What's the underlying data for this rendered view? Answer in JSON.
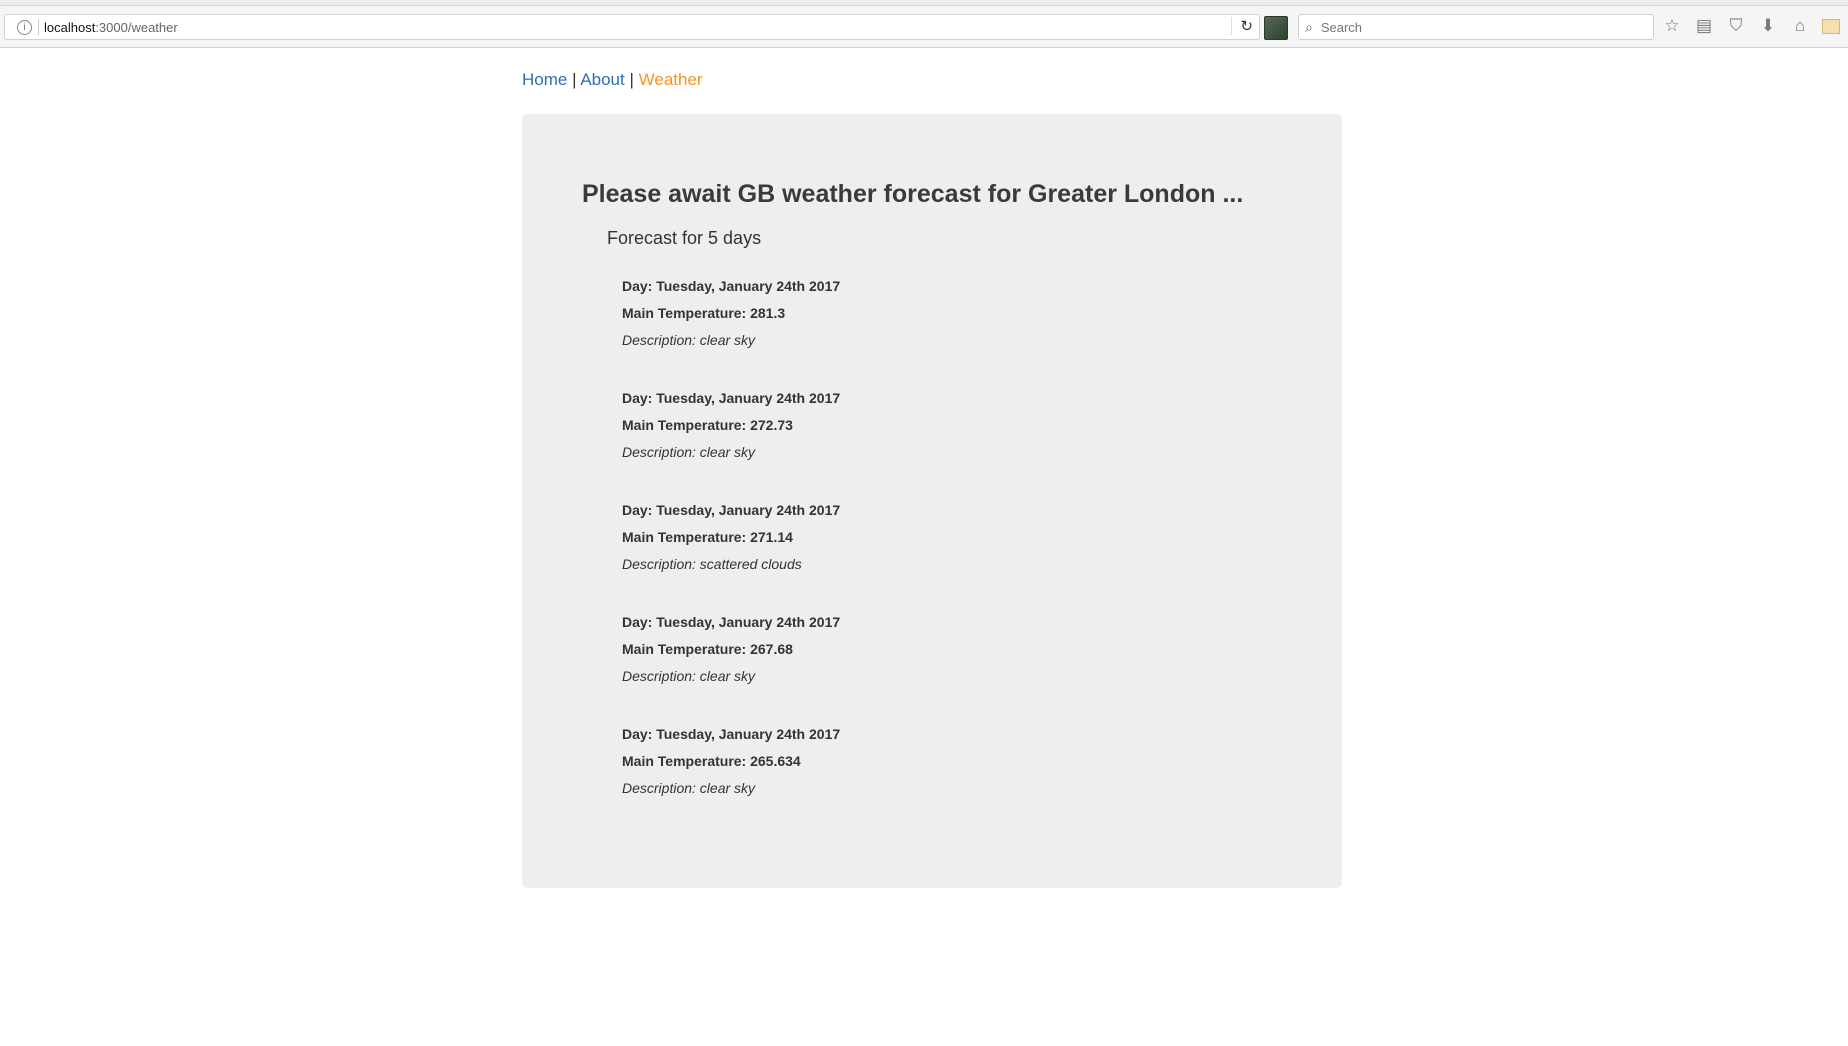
{
  "browser": {
    "url_host": "localhost",
    "url_rest": ":3000/weather",
    "search_placeholder": "Search"
  },
  "nav": {
    "home": "Home",
    "about": "About",
    "weather": "Weather",
    "separator": "|"
  },
  "main": {
    "title": "Please await GB weather forecast for Greater London ...",
    "subtitle": "Forecast for 5 days",
    "forecasts": [
      {
        "day": "Day: Tuesday, January 24th 2017",
        "temp": "Main Temperature: 281.3",
        "desc": "Description: clear sky"
      },
      {
        "day": "Day: Tuesday, January 24th 2017",
        "temp": "Main Temperature: 272.73",
        "desc": "Description: clear sky"
      },
      {
        "day": "Day: Tuesday, January 24th 2017",
        "temp": "Main Temperature: 271.14",
        "desc": "Description: scattered clouds"
      },
      {
        "day": "Day: Tuesday, January 24th 2017",
        "temp": "Main Temperature: 267.68",
        "desc": "Description: clear sky"
      },
      {
        "day": "Day: Tuesday, January 24th 2017",
        "temp": "Main Temperature: 265.634",
        "desc": "Description: clear sky"
      }
    ]
  }
}
